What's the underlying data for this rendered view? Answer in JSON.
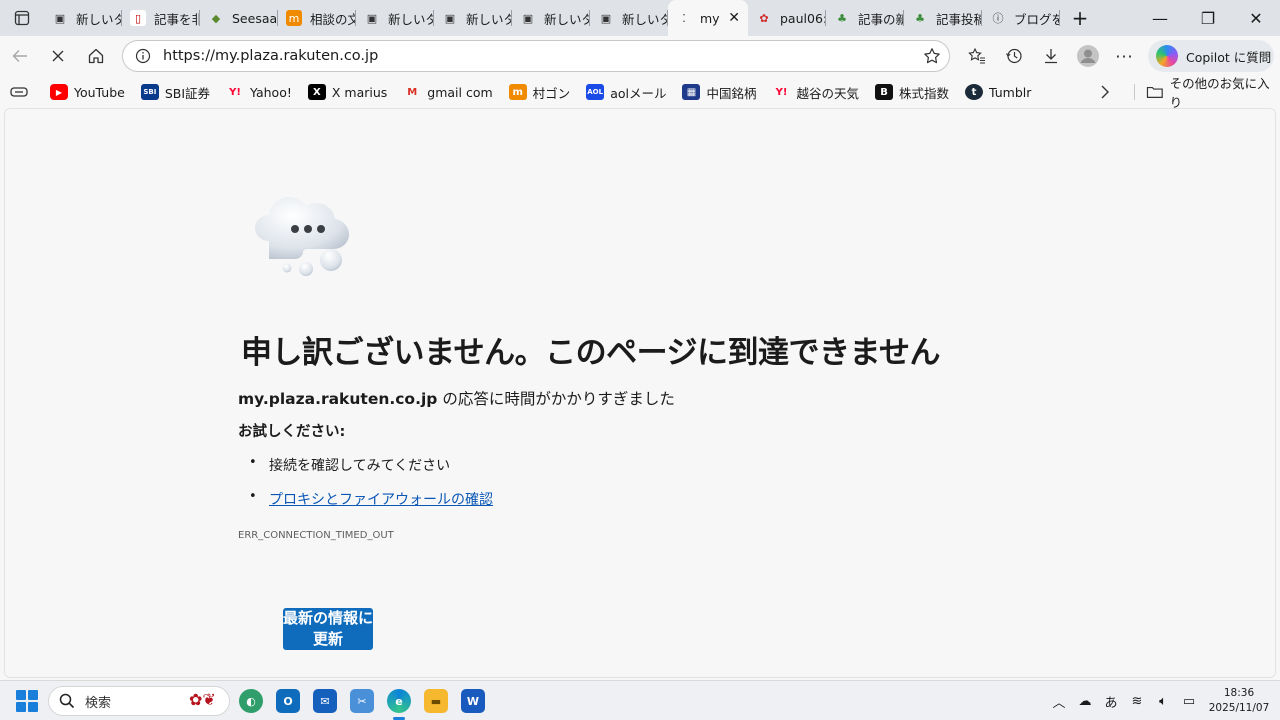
{
  "browser": {
    "tabs": [
      {
        "title": "新しいタ",
        "icon": "tab-page-icon",
        "active": false
      },
      {
        "title": "記事を非",
        "icon": "rakuten-blog-icon",
        "active": false
      },
      {
        "title": "Seesaa",
        "icon": "seesaa-icon",
        "active": false
      },
      {
        "title": "相談の文",
        "icon": "m-orange-icon",
        "active": false
      },
      {
        "title": "新しいタ",
        "icon": "tab-page-icon",
        "active": false
      },
      {
        "title": "新しいタ",
        "icon": "tab-page-icon",
        "active": false
      },
      {
        "title": "新しいタ",
        "icon": "tab-page-icon",
        "active": false
      },
      {
        "title": "新しいタ",
        "icon": "tab-page-icon",
        "active": false
      },
      {
        "title": "my",
        "icon": "loading-icon",
        "active": true
      },
      {
        "title": "paul06:",
        "icon": "red-character-icon",
        "active": false
      },
      {
        "title": "記事の新",
        "icon": "green-character-icon",
        "active": false
      },
      {
        "title": "記事投稿",
        "icon": "green-character-icon",
        "active": false
      },
      {
        "title": "ブログを",
        "icon": "info-circle-icon",
        "active": false
      }
    ],
    "address": {
      "url": "https://my.plaza.rakuten.co.jp"
    },
    "copilot_label": "Copilot に質問",
    "bookmarks": [
      {
        "label": "YouTube",
        "icon": "youtube-icon",
        "color": "#ff0000"
      },
      {
        "label": "SBI証券",
        "icon": "sbi-icon",
        "color": "#0a3a8c"
      },
      {
        "label": "Yahoo!",
        "icon": "yahoo-icon",
        "color": "#ff0033"
      },
      {
        "label": "X marius",
        "icon": "x-icon",
        "color": "#000000"
      },
      {
        "label": "gmail com",
        "icon": "gmail-icon",
        "color": "#d93025"
      },
      {
        "label": "村ゴン",
        "icon": "m-orange-icon",
        "color": "#f08a00"
      },
      {
        "label": "aolメール",
        "icon": "aol-icon",
        "color": "#1a4be6"
      },
      {
        "label": "中国銘柄",
        "icon": "chart-site-icon",
        "color": "#1e3a8a"
      },
      {
        "label": "越谷の天気",
        "icon": "yahoo-icon",
        "color": "#ff0033"
      },
      {
        "label": "株式指数",
        "icon": "b-icon",
        "color": "#111111"
      },
      {
        "label": "Tumblr",
        "icon": "tumblr-icon",
        "color": "#1b2b3a"
      }
    ],
    "other_bookmarks": "その他のお気に入り"
  },
  "page": {
    "title": "申し訳ございません。このページに到達できません",
    "host": "my.plaza.rakuten.co.jp",
    "desc_suffix": " の応答に時間がかかりすぎました",
    "try_label": "お試しください:",
    "suggestions": [
      {
        "text": "接続を確認してみてください",
        "link": false
      },
      {
        "text": "プロキシとファイアウォールの確認",
        "link": true
      }
    ],
    "error_code": "ERR_CONNECTION_TIMED_OUT",
    "refresh_label": "最新の情報に更新"
  },
  "taskbar": {
    "search_placeholder": "検索",
    "ime": "あ",
    "time": "18:36",
    "date": "2025/11/07"
  }
}
